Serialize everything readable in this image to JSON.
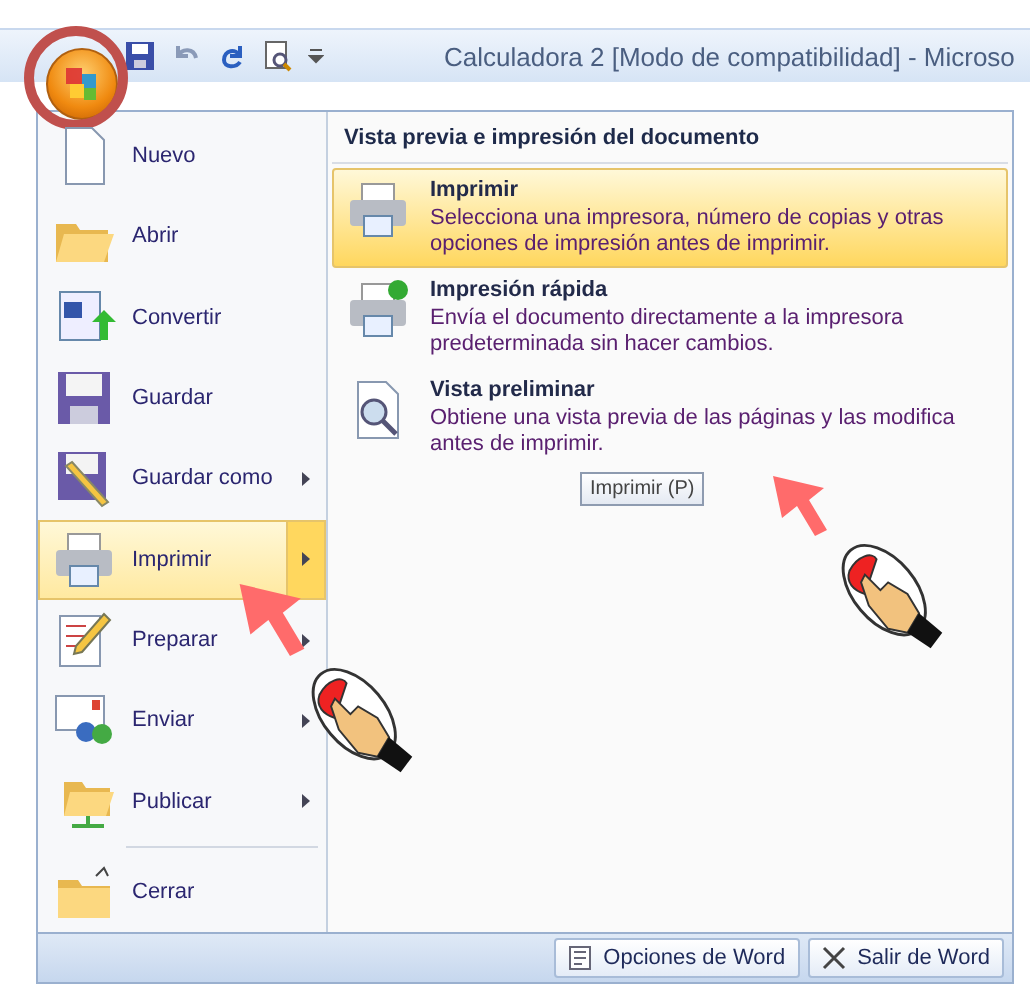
{
  "window": {
    "title": "Calculadora 2 [Modo de compatibilidad] - Microso"
  },
  "menu_items": [
    {
      "label": "Nuevo",
      "selected": false,
      "has_submenu": false
    },
    {
      "label": "Abrir",
      "selected": false,
      "has_submenu": false
    },
    {
      "label": "Convertir",
      "selected": false,
      "has_submenu": false
    },
    {
      "label": "Guardar",
      "selected": false,
      "has_submenu": false
    },
    {
      "label": "Guardar como",
      "selected": false,
      "has_submenu": true
    },
    {
      "label": "Imprimir",
      "selected": true,
      "has_submenu": true
    },
    {
      "label": "Preparar",
      "selected": false,
      "has_submenu": true
    },
    {
      "label": "Enviar",
      "selected": false,
      "has_submenu": true
    },
    {
      "label": "Publicar",
      "selected": false,
      "has_submenu": true
    },
    {
      "label": "Cerrar",
      "selected": false,
      "has_submenu": false
    }
  ],
  "submenu": {
    "heading": "Vista previa e impresión del documento",
    "items": [
      {
        "title": "Imprimir",
        "description": "Selecciona una impresora, número de copias y otras opciones de impresión antes de imprimir.",
        "selected": true
      },
      {
        "title": "Impresión rápida",
        "description": "Envía el documento directamente a la impresora predeterminada sin hacer cambios.",
        "selected": false
      },
      {
        "title": "Vista preliminar",
        "description": "Obtiene una vista previa de las páginas y las modifica antes de imprimir.",
        "selected": false
      }
    ]
  },
  "tooltip": "Imprimir (P)",
  "footer_buttons": [
    "Opciones de Word",
    "Salir de Word"
  ]
}
